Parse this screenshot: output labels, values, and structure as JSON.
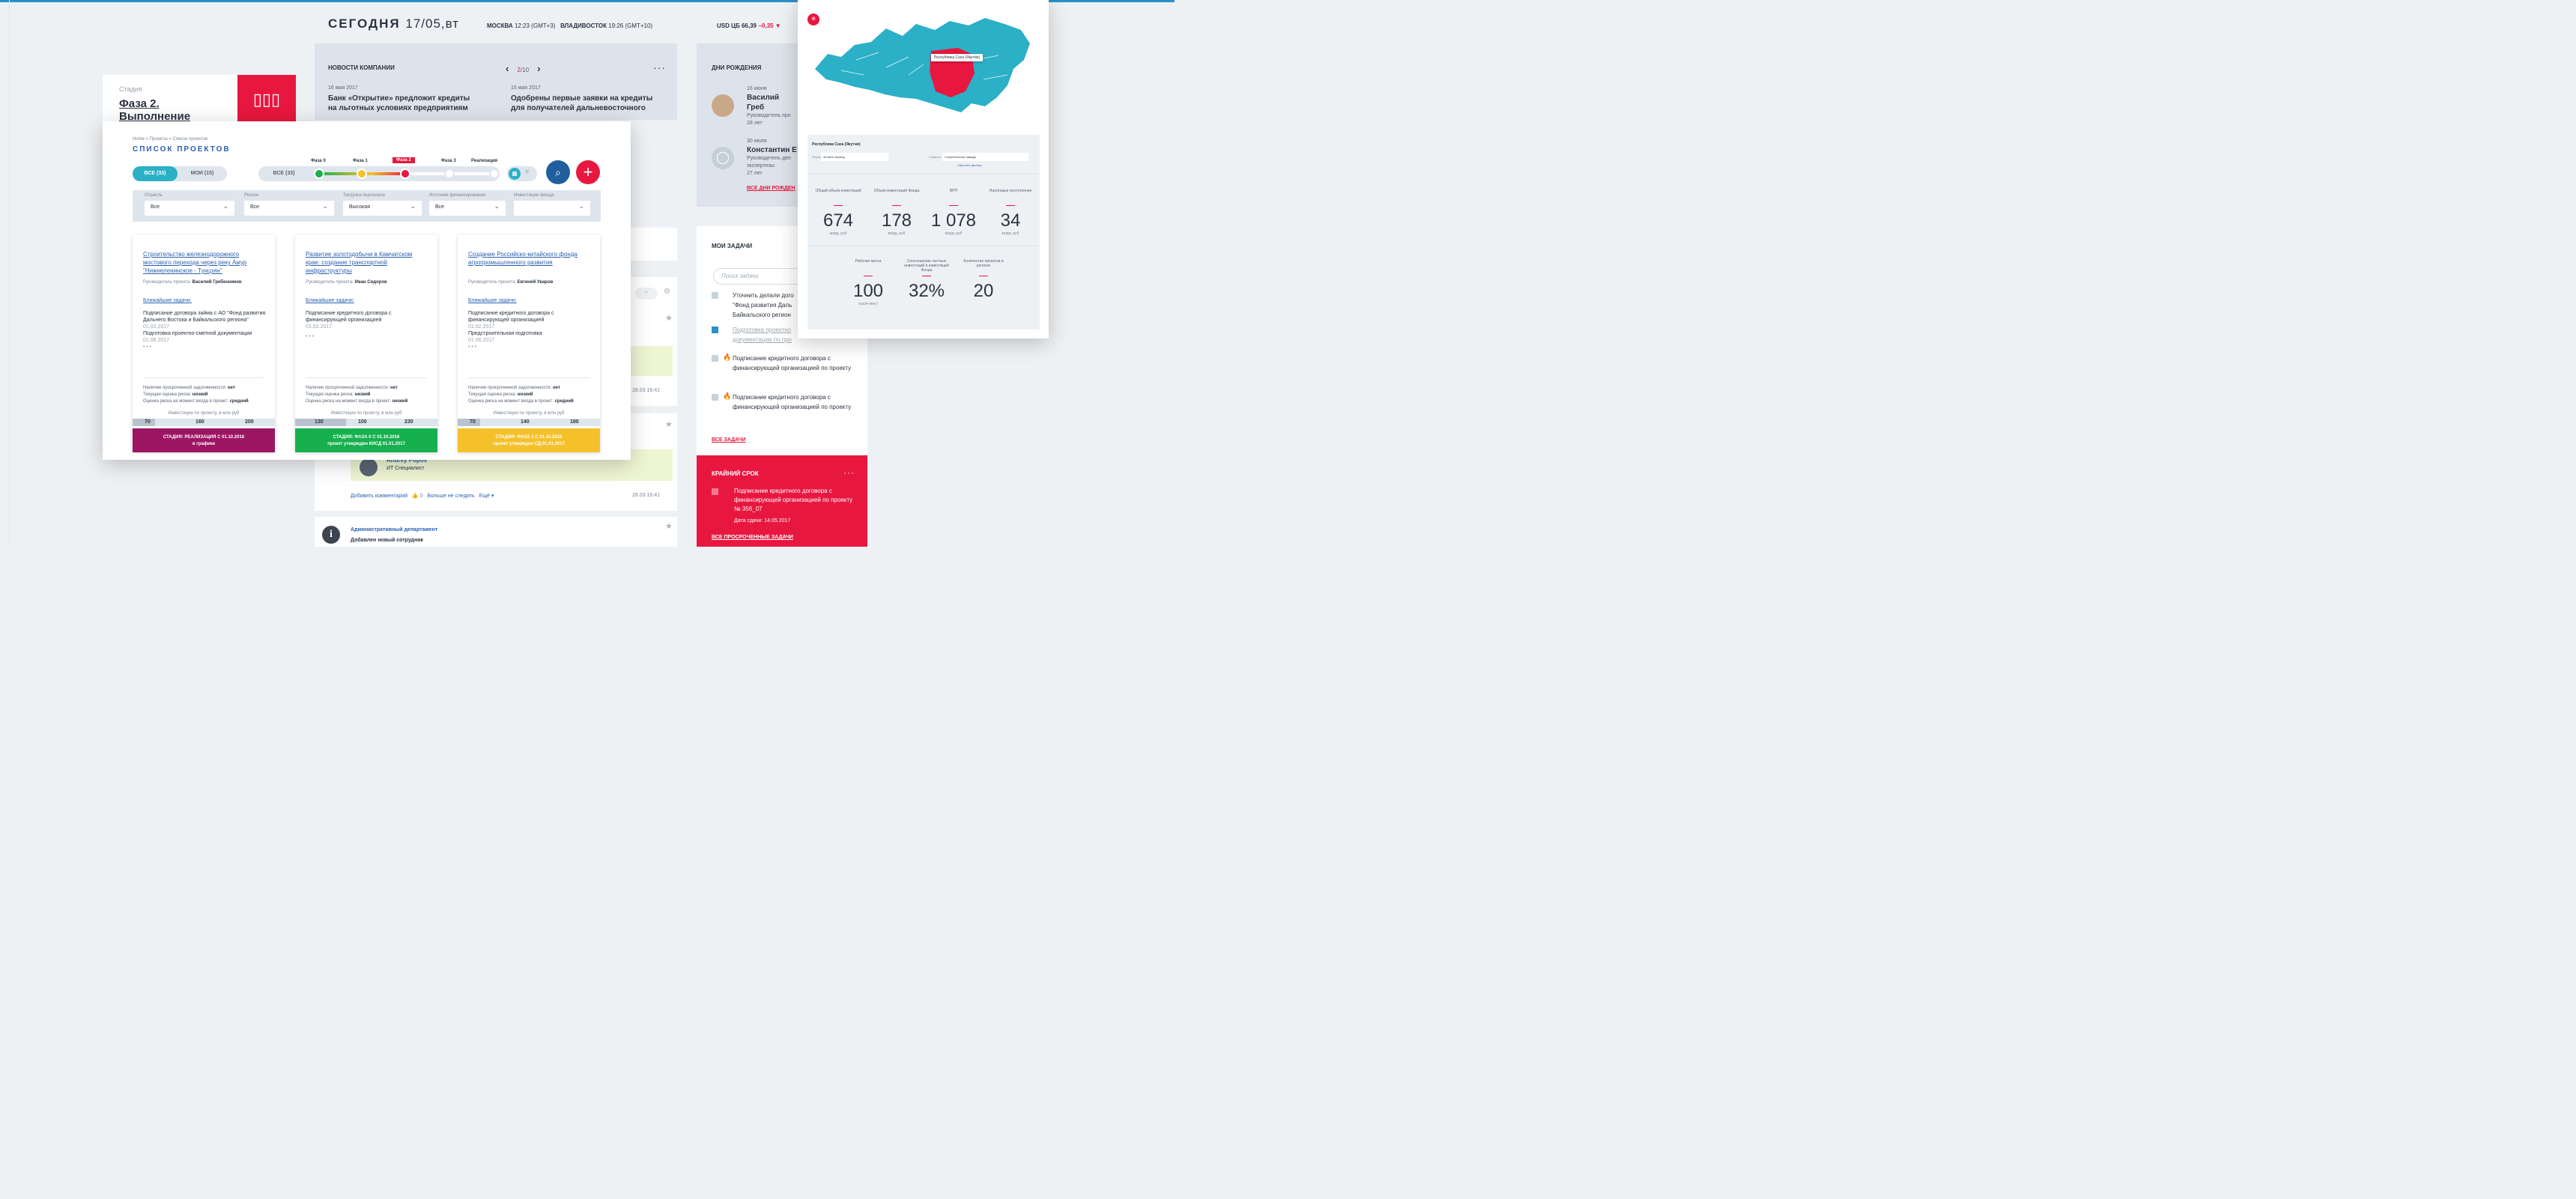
{
  "header": {
    "today_label": "СЕГОДНЯ",
    "today_date": "17/05,вт",
    "moscow_city": "МОСКВА",
    "moscow_time": "12:23 (GMT+3)",
    "vladivostok_city": "ВЛАДИВОСТОК",
    "vladivostok_time": "19:26 (GMT+10)",
    "usd_label": "USD ЦБ",
    "usd_value": "66,39",
    "usd_change": "−0,35 ▼"
  },
  "colors": {
    "accent_red": "#e8173f",
    "accent_blue": "#2b5fb0",
    "teal": "#2bb0c7",
    "green": "#17b04f",
    "purple": "#9c1563",
    "yellow": "#f5c12b"
  },
  "news": {
    "title": "НОВОСТИ КОМПАНИИ",
    "page_current": "2",
    "page_total": "/10",
    "prev_icon": "‹",
    "next_icon": "›",
    "more_icon": "···",
    "items": [
      {
        "date": "16 мая 2017",
        "title": "Банк «Открытие» предложит кредиты на льготных условиях предприятиям Дальнего Востока"
      },
      {
        "date": "15 мая 2017",
        "title": "Одобрены первые заявки на кредиты для получателей дальневосточного гектара"
      }
    ]
  },
  "birthdays": {
    "title": "ДНИ РОЖДЕНИЯ",
    "people": [
      {
        "date": "16 июня",
        "name": "Василий Греб",
        "role": "Руководитель про",
        "age": "28 лет"
      },
      {
        "date": "30 июля",
        "name": "Константин Е",
        "role": "Руководитель деп",
        "role2": "экспертизы",
        "age": "27 лет"
      }
    ],
    "all_link": "ВСЕ ДНИ РОЖДЕН"
  },
  "stage_card": {
    "label": "Стадия",
    "value_line1": "Фаза 2.",
    "value_line2": "Выполнение",
    "icon": "bar-chart-icon"
  },
  "projects": {
    "breadcrumb": "Home » Проекты » Список проектов",
    "title": "СПИСОК ПРОЕКТОВ",
    "tab_all": "ВСЕ (33)",
    "tab_mine": "МОИ (15)",
    "phase_all": "ВСЕ (33)",
    "phases": [
      "Фаза 0",
      "Фаза 1",
      "Фаза 2",
      "Фаза 3",
      "Реализация"
    ],
    "active_phase": "Фаза 2",
    "filters": [
      {
        "label": "Отрасль",
        "value": "Все"
      },
      {
        "label": "Регион",
        "value": "Все"
      },
      {
        "label": "Загрузка персонала",
        "value": "Высокая"
      },
      {
        "label": "Источник финансирования",
        "value": "Все"
      },
      {
        "label": "Инвестиции фонда",
        "value": ""
      }
    ],
    "cards": [
      {
        "title": "Строительство железнодорожного мостового перехода через реку Амур \"Нижнеленинское - Тунцзян\"",
        "manager_label": "Руководитель проекта:",
        "manager": "Василий Гребенников",
        "near_label": "Ближайшие задачи:",
        "task1": "Подписание договора займа с АО \"Фонд развития Дальнего Востока и Байкальского региона\"",
        "task1_date": "01.02.2017",
        "task2": "Подготовка проектно-сметной документации",
        "task2_date": "01.06.2017",
        "ellipsis": "• • •",
        "risk1_label": "Наличие просроченной задолженности:",
        "risk1": "нет",
        "risk2_label": "Текущая оценка риска:",
        "risk2": "низкий",
        "risk3_label": "Оценка риска на момент входа в проект:",
        "risk3": "средний",
        "inv_label": "Инвестиции по проекту, в млн руб",
        "scale": [
          "70",
          "160",
          "200"
        ],
        "footer1": "СТАДИЯ: РЕАЛИЗАЦИЯ С 01.10.2016",
        "footer2": "в графике"
      },
      {
        "title": "Развитие золотодобычи в Камчатском крае: создание транспортной инфраструктуры",
        "manager_label": "Руководитель проекта:",
        "manager": "Иван Сидоров",
        "near_label": "Ближайшие задачи:",
        "task1": "Подписание кредитного договора с финансирующей организацией",
        "task1_date": "01.02.2017",
        "task2": "",
        "task2_date": "",
        "ellipsis": "• • •",
        "risk1_label": "Наличие просроченной задолженности:",
        "risk1": "нет",
        "risk2_label": "Текущая оценка риска:",
        "risk2": "низкий",
        "risk3_label": "Оценка риска на момент входа в проект:",
        "risk3": "низкий",
        "inv_label": "Инвестиции по проекту, в млн руб",
        "scale": [
          "130",
          "100",
          "230"
        ],
        "footer1": "СТАДИЯ: ФАЗА 0 С 01.10.2016",
        "footer2": "проект утвержден КИСД 01.01.2017"
      },
      {
        "title": "Создание Российско-китайского фонда агропромышленного развития",
        "manager_label": "Руководитель проекта:",
        "manager": "Евгений Уваров",
        "near_label": "Ближайшие задачи:",
        "task1": "Подписание кредитного договора с финансирующей организацией",
        "task1_date": "01.02.2017",
        "task2": "Предстроительная подготовка",
        "task2_date": "01.06.2017",
        "ellipsis": "• • •",
        "risk1_label": "Наличие просроченной задолженности:",
        "risk1": "нет",
        "risk2_label": "Текущая оценка риска:",
        "risk2": "низкий",
        "risk3_label": "Оценка риска на момент входа в проект:",
        "risk3": "средний",
        "inv_label": "Инвестиции по проекту, в млн руб",
        "scale": [
          "70",
          "140",
          "180"
        ],
        "footer1": "СТАДИЯ: ФАЗА 1 С 01.10.2016",
        "footer2": "проект утвержден СД 01.01.2017"
      }
    ]
  },
  "feed": {
    "user_name": "Andrey Popov",
    "user_role": "ИТ Специалист",
    "add_comment": "Добавить комментарий",
    "likes": "0",
    "unfollow": "Больше не следить",
    "more": "Ещё ▾",
    "time1": "28.03 16:41",
    "time2": "28.03 16:41",
    "dept": "Административный департамент",
    "dept_msg": "Добавлен новый сотрудник",
    "ellipsis_text": "т..."
  },
  "tasks": {
    "title": "МОИ ЗАДАЧИ",
    "search_placeholder": "Поиск задачи",
    "items": [
      {
        "text": "Уточнить делали дого \"Фонд развития Даль Байкальского регион",
        "done": false
      },
      {
        "text": "Подготовка проектно документации по про",
        "done": true
      },
      {
        "text": "Подписание кредитного договора с финансирующей организацией по проекту",
        "done": false,
        "fire": true
      },
      {
        "text": "Подписание кредитного договора с финансирующей организацией по проекту",
        "done": false,
        "fire": true
      }
    ],
    "all_link": "ВСЕ ЗАДАЧИ"
  },
  "deadline": {
    "title": "КРАЙНИЙ СРОК",
    "dots": "···",
    "text": "Подписание кредитного договора с финансирующей организацией по проекту № 356_07",
    "date": "Дата сдачи: 14.05.2017",
    "all_link": "ВСЕ ПРОСРОЧЕННЫЕ ЗАДАЧИ"
  },
  "map": {
    "region": "Республика Саха (Якутия)",
    "map_label": "Республика Саха (Якутия)",
    "period_label": "Период",
    "period_value": "За весь период",
    "branch_label": "Отрасль",
    "branch_value": "Строительство завода",
    "reset": "Сбросить фильтр",
    "stats_row1": [
      {
        "label": "Общий объем инвестиций",
        "value": "674",
        "unit": "млрд. руб"
      },
      {
        "label": "Объем инвестиций Фонда",
        "value": "178",
        "unit": "млрд. руб"
      },
      {
        "label": "ВРП",
        "value": "1 078",
        "unit": "млрд. руб"
      },
      {
        "label": "Налоговые поступления",
        "value": "34",
        "unit": "млрд. руб"
      }
    ],
    "stats_row2": [
      {
        "label": "Рабочие места",
        "value": "100",
        "unit": "тысяч мест"
      },
      {
        "label": "Соотношение частных инвестиций и инвестиций Фонда",
        "value": "32%",
        "unit": ""
      },
      {
        "label": "Количество проектов в регионе",
        "value": "20",
        "unit": ""
      }
    ]
  }
}
